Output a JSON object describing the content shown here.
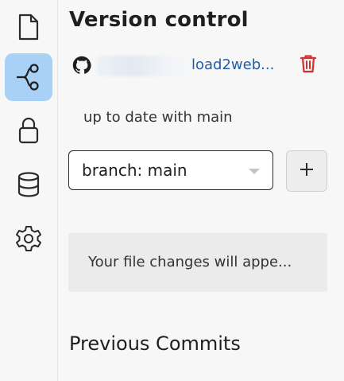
{
  "sidebar": {
    "items": [
      {
        "name": "file",
        "icon": "file-icon"
      },
      {
        "name": "version-control",
        "icon": "branch-icon",
        "active": true
      },
      {
        "name": "lock",
        "icon": "lock-icon"
      },
      {
        "name": "database",
        "icon": "database-icon"
      },
      {
        "name": "settings",
        "icon": "gear-icon"
      }
    ],
    "active_color": "#a9d1f5"
  },
  "panel": {
    "title": "Version control",
    "repo": {
      "icon": "github-icon",
      "name_visible": "load2web...",
      "delete_icon": "trash-icon",
      "link_color": "#1e5ea8",
      "delete_color": "#d62f2f"
    },
    "status": "up to date with main",
    "branch": {
      "label": "branch: main",
      "add_icon": "plus-icon"
    },
    "changes_placeholder": "Your file changes will appe...",
    "previous_commits_heading": "Previous Commits"
  }
}
